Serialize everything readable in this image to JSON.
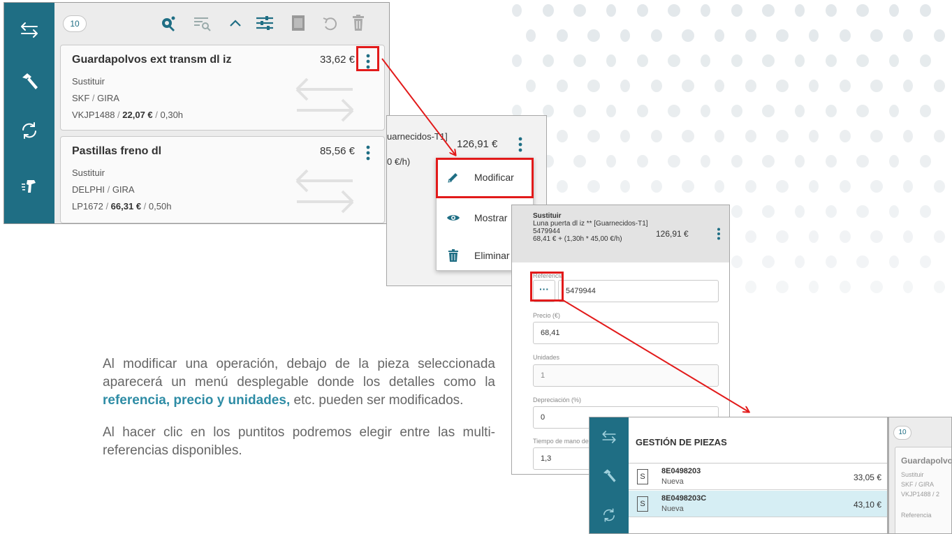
{
  "panel1": {
    "count": "10",
    "cards": [
      {
        "title": "Guardapolvos ext transm dl iz",
        "price": "33,62 €",
        "action": "Sustituir",
        "brand": "SKF",
        "supplier": "GIRA",
        "ref": "VKJP1488",
        "unit_price": "22,07 €",
        "time": "0,30h"
      },
      {
        "title": "Pastillas freno dl",
        "price": "85,56 €",
        "action": "Sustituir",
        "brand": "DELPHI",
        "supplier": "GIRA",
        "ref": "LP1672",
        "unit_price": "66,31 €",
        "time": "0,50h"
      }
    ]
  },
  "panel2": {
    "line1": "uarnecidos-T1]",
    "line2": "0 €/h)",
    "price": "126,91 €"
  },
  "menu": {
    "items": [
      {
        "label": "Modificar",
        "icon": "pencil-icon"
      },
      {
        "label": "Mostrar",
        "icon": "eye-icon"
      },
      {
        "label": "Eliminar",
        "icon": "trash-icon"
      }
    ]
  },
  "panel3": {
    "action": "Sustituir",
    "name": "Luna puerta dl iz ** [Guarnecidos-T1]",
    "code": "5479944",
    "cost": "68,41 € + (1,30h * 45,00 €/h)",
    "price": "126,91 €",
    "fields": {
      "referencia_label": "Referencia",
      "referencia_value": "5479944",
      "dots_label": "···",
      "precio_label": "Precio (€)",
      "precio_value": "68,41",
      "unidades_label": "Unidades",
      "unidades_value": "1",
      "depreciacion_label": "Depreciación (%)",
      "depreciacion_value": "0",
      "tiempo_label": "Tiempo de mano de obra",
      "tiempo_value": "1,3"
    }
  },
  "panel4": {
    "title": "GESTIÓN DE PIEZAS",
    "rows": [
      {
        "tag": "S",
        "code": "8E0498203",
        "state": "Nueva",
        "price": "33,05 €",
        "selected": false
      },
      {
        "tag": "S",
        "code": "8E0498203C",
        "state": "Nueva",
        "price": "43,10 €",
        "selected": true
      }
    ],
    "right": {
      "count": "10",
      "title": "Guardapolvos",
      "action": "Sustituir",
      "brand_supplier": "SKF / GIRA",
      "ref": "VKJP1488 / 2",
      "ref_label": "Referencia"
    }
  },
  "description": {
    "p1_a": "Al modificar una operación, debajo de la pieza seleccionada aparecerá un menú desplegable donde los detalles como la ",
    "p1_hl": "referencia, precio y unidades,",
    "p1_b": " etc. pueden ser modificados.",
    "p2": "Al hacer clic en los puntitos podremos elegir entre las multi-referencias disponibles."
  },
  "colors": {
    "sidebar": "#1f6e84",
    "accent": "#1f6e84",
    "highlight_red": "#e21a1a",
    "selected_row": "#d6eef4",
    "text_highlight": "#2e8ca5"
  }
}
